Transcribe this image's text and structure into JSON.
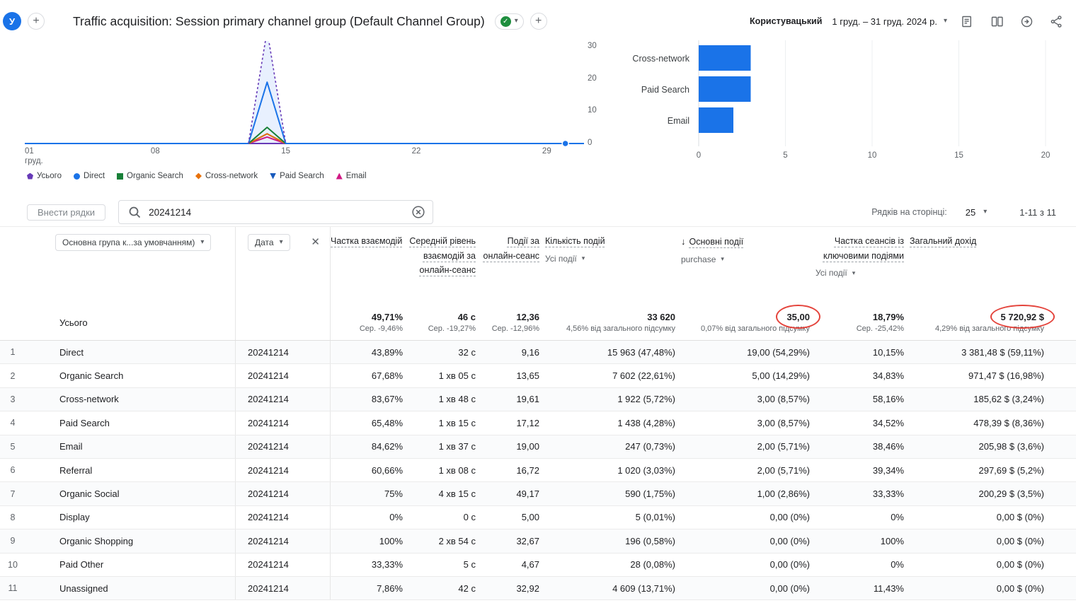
{
  "header": {
    "avatar_letter": "У",
    "title": "Traffic acquisition: Session primary channel group (Default Channel Group)",
    "user_mode": "Користувацький",
    "date_range": "1 груд. – 31 груд. 2024 р."
  },
  "chart_data": [
    {
      "type": "line",
      "x_axis": {
        "days": 31,
        "tick_labels": [
          "01 груд.",
          "08",
          "15",
          "22",
          "29"
        ],
        "tick_day_indexes": [
          0,
          7,
          14,
          21,
          28
        ]
      },
      "y_axis": {
        "ticks": [
          0,
          10,
          20,
          30
        ],
        "max": 30
      },
      "series": [
        {
          "name": "Усього",
          "color": "#673ab7",
          "marker": "pentagon",
          "style": "dashed",
          "values": [
            0,
            0,
            0,
            0,
            0,
            0,
            0,
            0,
            0,
            0,
            0,
            0,
            0,
            35,
            0,
            0,
            0,
            0,
            0,
            0,
            0,
            0,
            0,
            0,
            0,
            0,
            0,
            0,
            0,
            0,
            0
          ]
        },
        {
          "name": "Direct",
          "color": "#1a73e8",
          "marker": "circle",
          "values": [
            0,
            0,
            0,
            0,
            0,
            0,
            0,
            0,
            0,
            0,
            0,
            0,
            0,
            19,
            0,
            0,
            0,
            0,
            0,
            0,
            0,
            0,
            0,
            0,
            0,
            0,
            0,
            0,
            0,
            0,
            0
          ]
        },
        {
          "name": "Organic Search",
          "color": "#188038",
          "marker": "square",
          "values": [
            0,
            0,
            0,
            0,
            0,
            0,
            0,
            0,
            0,
            0,
            0,
            0,
            0,
            5,
            0,
            0,
            0,
            0,
            0,
            0,
            0,
            0,
            0,
            0,
            0,
            0,
            0,
            0,
            0,
            0,
            0
          ]
        },
        {
          "name": "Cross-network",
          "color": "#e8710a",
          "marker": "diamond",
          "values": [
            0,
            0,
            0,
            0,
            0,
            0,
            0,
            0,
            0,
            0,
            0,
            0,
            0,
            3,
            0,
            0,
            0,
            0,
            0,
            0,
            0,
            0,
            0,
            0,
            0,
            0,
            0,
            0,
            0,
            0,
            0
          ]
        },
        {
          "name": "Paid Search",
          "color": "#185abc",
          "marker": "triangle-down",
          "values": [
            0,
            0,
            0,
            0,
            0,
            0,
            0,
            0,
            0,
            0,
            0,
            0,
            0,
            3,
            0,
            0,
            0,
            0,
            0,
            0,
            0,
            0,
            0,
            0,
            0,
            0,
            0,
            0,
            0,
            0,
            0
          ]
        },
        {
          "name": "Email",
          "color": "#d01884",
          "marker": "triangle-up",
          "values": [
            0,
            0,
            0,
            0,
            0,
            0,
            0,
            0,
            0,
            0,
            0,
            0,
            0,
            2,
            0,
            0,
            0,
            0,
            0,
            0,
            0,
            0,
            0,
            0,
            0,
            0,
            0,
            0,
            0,
            0,
            0
          ]
        }
      ],
      "end_marker": {
        "day_index": 29,
        "value": 0,
        "color": "#1a73e8"
      }
    },
    {
      "type": "bar",
      "orientation": "horizontal",
      "categories": [
        "Cross-network",
        "Paid Search",
        "Email"
      ],
      "values": [
        3,
        3,
        2
      ],
      "x_axis": {
        "ticks": [
          0,
          5,
          10,
          15,
          20
        ],
        "max": 20
      },
      "bar_color": "#1a73e8"
    }
  ],
  "toolbar": {
    "insert_rows_label": "Внести рядки",
    "search_value": "20241214",
    "rows_per_page_label": "Рядків на сторінці:",
    "rows_per_page_value": "25",
    "pagination": "1-11 з 11"
  },
  "table": {
    "primary_dimension": "Основна група к...за умовчанням)",
    "secondary_dimension": "Дата",
    "columns": [
      {
        "label": "Частка взаємодій"
      },
      {
        "label": "Середній рівень взаємодій за онлайн-сеанс"
      },
      {
        "label": "Події за онлайн-сеанс"
      },
      {
        "label": "Кількість подій",
        "sub": "Усі події"
      },
      {
        "label": "Основні події",
        "sub": "purchase",
        "sorted": true
      },
      {
        "label": "Частка сеансів із ключовими подіями",
        "sub": "Усі події"
      },
      {
        "label": "Загальний дохід"
      }
    ],
    "totals": {
      "label": "Усього",
      "cells": [
        {
          "value": "49,71%",
          "sub": "Сер. -9,46%"
        },
        {
          "value": "46 с",
          "sub": "Сер. -19,27%"
        },
        {
          "value": "12,36",
          "sub": "Сер. -12,96%"
        },
        {
          "value": "33 620",
          "sub": "4,56% від загального підсумку"
        },
        {
          "value": "35,00",
          "sub": "0,07% від загального підсумку",
          "circled": true
        },
        {
          "value": "18,79%",
          "sub": "Сер. -25,42%"
        },
        {
          "value": "5 720,92 $",
          "sub": "4,29% від загального підсумку",
          "circled": true
        }
      ]
    },
    "rows": [
      {
        "num": 1,
        "channel": "Direct",
        "date": "20241214",
        "values": [
          "43,89%",
          "32 с",
          "9,16",
          "15 963 (47,48%)",
          "19,00 (54,29%)",
          "10,15%",
          "3 381,48 $ (59,11%)"
        ]
      },
      {
        "num": 2,
        "channel": "Organic Search",
        "date": "20241214",
        "values": [
          "67,68%",
          "1 хв 05 с",
          "13,65",
          "7 602 (22,61%)",
          "5,00 (14,29%)",
          "34,83%",
          "971,47 $ (16,98%)"
        ]
      },
      {
        "num": 3,
        "channel": "Cross-network",
        "date": "20241214",
        "values": [
          "83,67%",
          "1 хв 48 с",
          "19,61",
          "1 922 (5,72%)",
          "3,00 (8,57%)",
          "58,16%",
          "185,62 $ (3,24%)"
        ]
      },
      {
        "num": 4,
        "channel": "Paid Search",
        "date": "20241214",
        "values": [
          "65,48%",
          "1 хв 15 с",
          "17,12",
          "1 438 (4,28%)",
          "3,00 (8,57%)",
          "34,52%",
          "478,39 $ (8,36%)"
        ]
      },
      {
        "num": 5,
        "channel": "Email",
        "date": "20241214",
        "values": [
          "84,62%",
          "1 хв 37 с",
          "19,00",
          "247 (0,73%)",
          "2,00 (5,71%)",
          "38,46%",
          "205,98 $ (3,6%)"
        ]
      },
      {
        "num": 6,
        "channel": "Referral",
        "date": "20241214",
        "values": [
          "60,66%",
          "1 хв 08 с",
          "16,72",
          "1 020 (3,03%)",
          "2,00 (5,71%)",
          "39,34%",
          "297,69 $ (5,2%)"
        ]
      },
      {
        "num": 7,
        "channel": "Organic Social",
        "date": "20241214",
        "values": [
          "75%",
          "4 хв 15 с",
          "49,17",
          "590 (1,75%)",
          "1,00 (2,86%)",
          "33,33%",
          "200,29 $ (3,5%)"
        ]
      },
      {
        "num": 8,
        "channel": "Display",
        "date": "20241214",
        "values": [
          "0%",
          "0 с",
          "5,00",
          "5 (0,01%)",
          "0,00 (0%)",
          "0%",
          "0,00 $ (0%)"
        ]
      },
      {
        "num": 9,
        "channel": "Organic Shopping",
        "date": "20241214",
        "values": [
          "100%",
          "2 хв 54 с",
          "32,67",
          "196 (0,58%)",
          "0,00 (0%)",
          "100%",
          "0,00 $ (0%)"
        ]
      },
      {
        "num": 10,
        "channel": "Paid Other",
        "date": "20241214",
        "values": [
          "33,33%",
          "5 с",
          "4,67",
          "28 (0,08%)",
          "0,00 (0%)",
          "0%",
          "0,00 $ (0%)"
        ]
      },
      {
        "num": 11,
        "channel": "Unassigned",
        "date": "20241214",
        "values": [
          "7,86%",
          "42 с",
          "32,92",
          "4 609 (13,71%)",
          "0,00 (0%)",
          "11,43%",
          "0,00 $ (0%)"
        ]
      }
    ]
  },
  "annotations": {
    "circle_color": "#e4443c"
  }
}
